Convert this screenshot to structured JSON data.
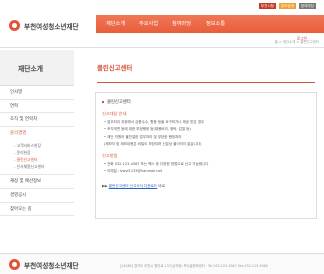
{
  "header": {
    "org_name": "부천여성청소년재단",
    "gnb": [
      "재단소개",
      "주요사업",
      "참여마당",
      "정보소통"
    ],
    "util": [
      "부천시청",
      "정보공개",
      "참여마당"
    ],
    "login": "로그인",
    "breadcrumb": "홈 > 재단소개 > 클린신고센터"
  },
  "sidebar": {
    "title": "재단소개",
    "items": [
      {
        "label": "인사말"
      },
      {
        "label": "연혁"
      },
      {
        "label": "조직 및 연락처"
      },
      {
        "label": "윤리경영"
      },
      {
        "label": "재정 및 예산정보"
      },
      {
        "label": "경영공시"
      },
      {
        "label": "찾아오는 길"
      }
    ],
    "subitems": [
      {
        "label": "- 고객서비스헌장"
      },
      {
        "label": "- 윤리헌장"
      },
      {
        "label": "- 클린신고센터"
      },
      {
        "label": "- 인사채용신고센터"
      }
    ]
  },
  "content": {
    "title": "클린신고센터",
    "box_heading": "클린신고센터",
    "section1": "신고대상 안내",
    "lines1": [
      "• 업무처리 과정에서 금품수수, 향응 등을 요구하거나 제공 받은 경우",
      "• 조직개편 등에 대한 부정행위 등(채용비리, 청탁, 갑질 등)",
      "• 재단 직원의 불친절한 업무처리 및 부당한 행정처리",
      "  (제보자 및 제보내용은 비밀이 보장되며 신분상 불이익이 없습니다)"
    ],
    "section2": "신고방법",
    "lines2": [
      "• 전화 032-123-4567 또는 팩스 등 다양한 방법으로 신고 가능합니다",
      "• 이메일 : bwyf1133@hanmail.net"
    ],
    "link_prefix": "▶▶ ",
    "link_text": "클린신고센터 신고서식 다운로드",
    "link_suffix": " 바로"
  },
  "footer": {
    "org_name": "부천여성청소년재단",
    "text": "[14585] 경기도 부천시 원미로 137(심곡동) 복사골문화센터 · Tel 032-123-4567 Fax 032-123-4568"
  }
}
